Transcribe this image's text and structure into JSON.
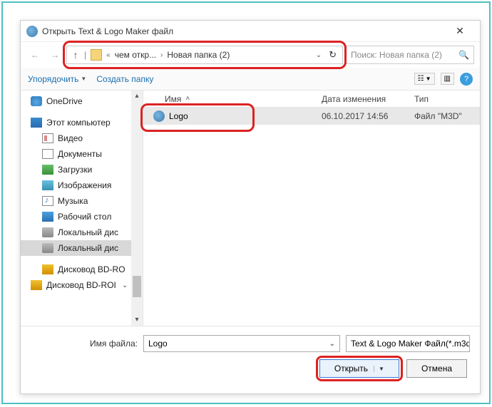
{
  "window": {
    "title": "Открыть Text & Logo Maker файл"
  },
  "breadcrumb": {
    "seg1": "чем откр...",
    "seg2": "Новая папка (2)"
  },
  "search": {
    "placeholder": "Поиск: Новая папка (2)"
  },
  "toolbar": {
    "organize": "Упорядочить",
    "newfolder": "Создать папку"
  },
  "tree": {
    "onedrive": "OneDrive",
    "thispc": "Этот компьютер",
    "video": "Видео",
    "docs": "Документы",
    "downloads": "Загрузки",
    "images": "Изображения",
    "music": "Музыка",
    "desktop": "Рабочий стол",
    "disk1": "Локальный дис",
    "disk2": "Локальный дис",
    "bd1": "Дисковод BD-RO",
    "bd2": "Дисковод BD-ROI"
  },
  "columns": {
    "name": "Имя",
    "modified": "Дата изменения",
    "type": "Тип"
  },
  "files": [
    {
      "name": "Logo",
      "modified": "06.10.2017 14:56",
      "type": "Файл \"M3D\""
    }
  ],
  "footer": {
    "filename_label": "Имя файла:",
    "filename_value": "Logo",
    "filter": "Text & Logo Maker Файл(*.m3d",
    "open": "Открыть",
    "cancel": "Отмена"
  }
}
